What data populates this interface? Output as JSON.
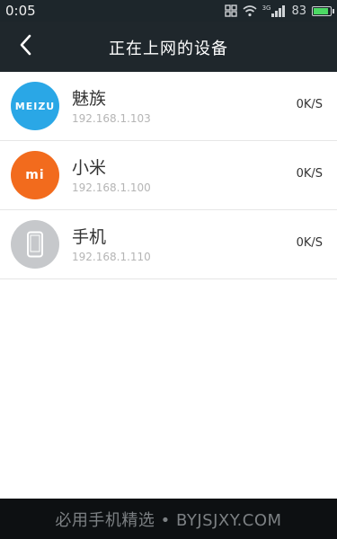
{
  "status_bar": {
    "time": "0:05",
    "network": "3G",
    "battery": "83"
  },
  "header": {
    "title": "正在上网的设备"
  },
  "devices": [
    {
      "name": "魅族",
      "ip": "192.168.1.103",
      "speed": "0K/S",
      "logo_text": "MEIZU",
      "icon": "meizu-logo",
      "color": "#2aa7e6"
    },
    {
      "name": "小米",
      "ip": "192.168.1.100",
      "speed": "0K/S",
      "logo_text": "mi",
      "icon": "xiaomi-logo",
      "color": "#f26b1d"
    },
    {
      "name": "手机",
      "ip": "192.168.1.110",
      "speed": "0K/S",
      "icon": "phone-icon",
      "color": "#c6c8cb"
    }
  ],
  "footer": {
    "watermark": "必用手机精选 • BYJSJXY.COM"
  }
}
